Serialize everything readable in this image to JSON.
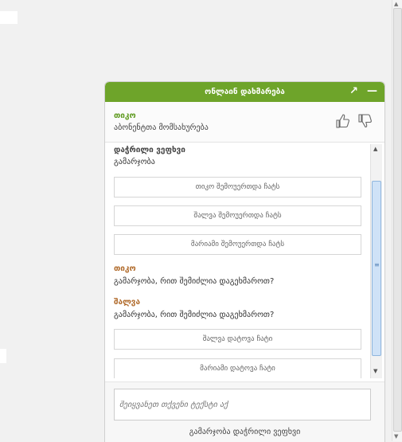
{
  "chat": {
    "title": "ონლაინ დახმარება",
    "header_buttons": {
      "expand_glyph": "↗",
      "minimize_glyph": "—"
    },
    "agent": {
      "name": "თიკო",
      "role": "აბონენტთა მომსახურება"
    },
    "icons": {
      "like": "thumbs-up-icon",
      "dislike": "thumbs-down-icon"
    },
    "messages": {
      "sender1": {
        "name": "დაჭრილი ვეფხვი",
        "text": "გამარჯობა",
        "color": "#444444"
      },
      "join1": "თიკო შემოუერთდა ჩატს",
      "join2": "შალვა შემოუერთდა ჩატს",
      "join3": "მარიამი შემოუერთდა ჩატს",
      "sender2": {
        "name": "თიკო",
        "text": "გამარჯობა, რით შემიძლია დაგეხმაროთ?",
        "color": "#b06a2a"
      },
      "sender3": {
        "name": "შალვა",
        "text": "გამარჯობა, რით შემიძლია დაგეხმაროთ?",
        "color": "#b06a2a"
      },
      "leave1": "შალვა დატოვა ჩატი",
      "leave2": "მარიამი დატოვა ჩატი"
    },
    "input": {
      "placeholder": "შეიყვანეთ თქვენი ტექსტი აქ"
    },
    "status": "გამარჯობა დაჭრილი ვეფხვი"
  },
  "colors": {
    "header_green": "#6ea42a",
    "agent_green": "#5e9a1f",
    "agent_brown": "#b06a2a"
  }
}
